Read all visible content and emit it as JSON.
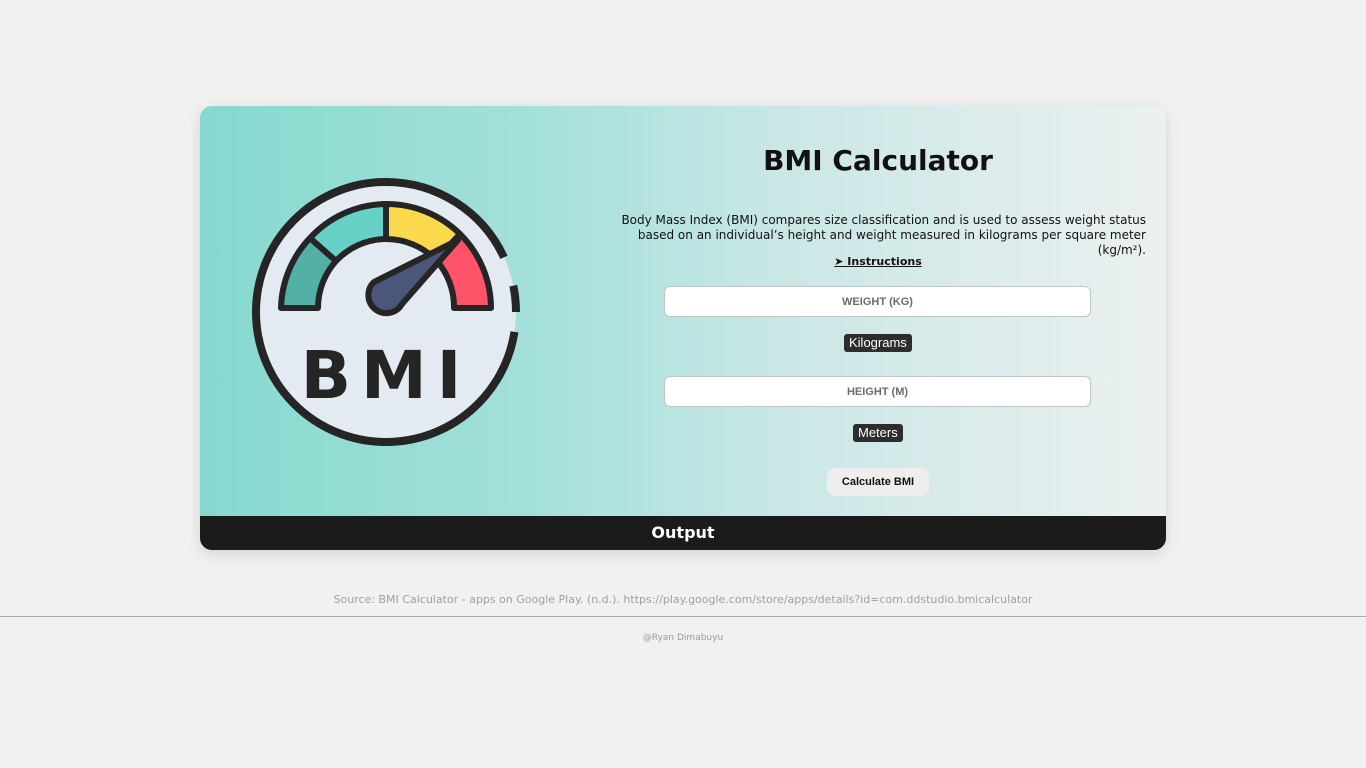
{
  "calculator": {
    "logo_text": "BMI",
    "title": "BMI Calculator",
    "description_lead": "Body Mass Index (BMI)",
    "description_rest": " compares size classification and is used to assess weight status based on an individual’s height and weight measured in kilograms per square meter (kg/m²).",
    "instructions_label": "➤ Instructions",
    "weight_placeholder": "WEIGHT (KG)",
    "weight_value": "",
    "weight_unit": "Kilograms",
    "height_placeholder": "HEIGHT (M)",
    "height_value": "",
    "height_unit": "Meters",
    "calculate_label": "Calculate BMI",
    "output_label": "Output"
  },
  "footer": {
    "source": "Source: BMI Calculator - apps on Google Play. (n.d.). https://play.google.com/store/apps/details?id=com.ddstudio.bmicalculator",
    "credit": "@Ryan Dimabuyu"
  },
  "colors": {
    "gradient_start": "#85d9cf",
    "gradient_end": "#ecf0f0",
    "output_bar": "#1b1b1b",
    "gauge_dark_teal": "#52b1a4",
    "gauge_teal": "#67d0c7",
    "gauge_yellow": "#fbd94c",
    "gauge_red": "#fe5368",
    "gauge_needle": "#4b5778",
    "gauge_face": "#e4eaf1"
  },
  "icons": {
    "logo": "bmi-gauge-icon"
  }
}
